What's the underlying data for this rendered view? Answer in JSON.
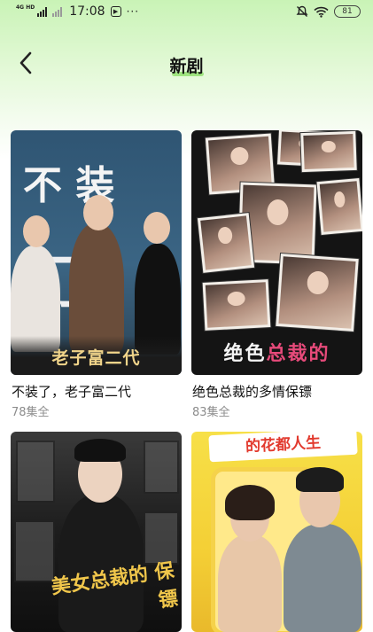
{
  "status_bar": {
    "network": "4G HD",
    "time": "17:08",
    "more": "···",
    "battery": "81",
    "icons": [
      "signal-icon",
      "app-notification-icon",
      "mute-icon",
      "wifi-icon",
      "battery-icon"
    ]
  },
  "header": {
    "back_icon": "back-arrow-icon",
    "title": "新剧"
  },
  "dramas": [
    {
      "title": "不装了，老子富二代",
      "episodes": "78集全",
      "cover_text_top": "不 装",
      "cover_text_mid": "了",
      "cover_text_bottom": "老子富二代"
    },
    {
      "title": "绝色总裁的多情保镖",
      "episodes": "83集全",
      "cover_text_a": "绝色",
      "cover_text_b": "总裁的"
    },
    {
      "title": "",
      "episodes": "",
      "cover_text": "美女总裁的 保镖"
    },
    {
      "title": "",
      "episodes": "",
      "cover_text": "的花都人生"
    }
  ],
  "colors": {
    "header_gradient_top": "#c9f3b6",
    "title_accent": "#8fe06a",
    "subtitle_gray": "#8c8c8c"
  }
}
